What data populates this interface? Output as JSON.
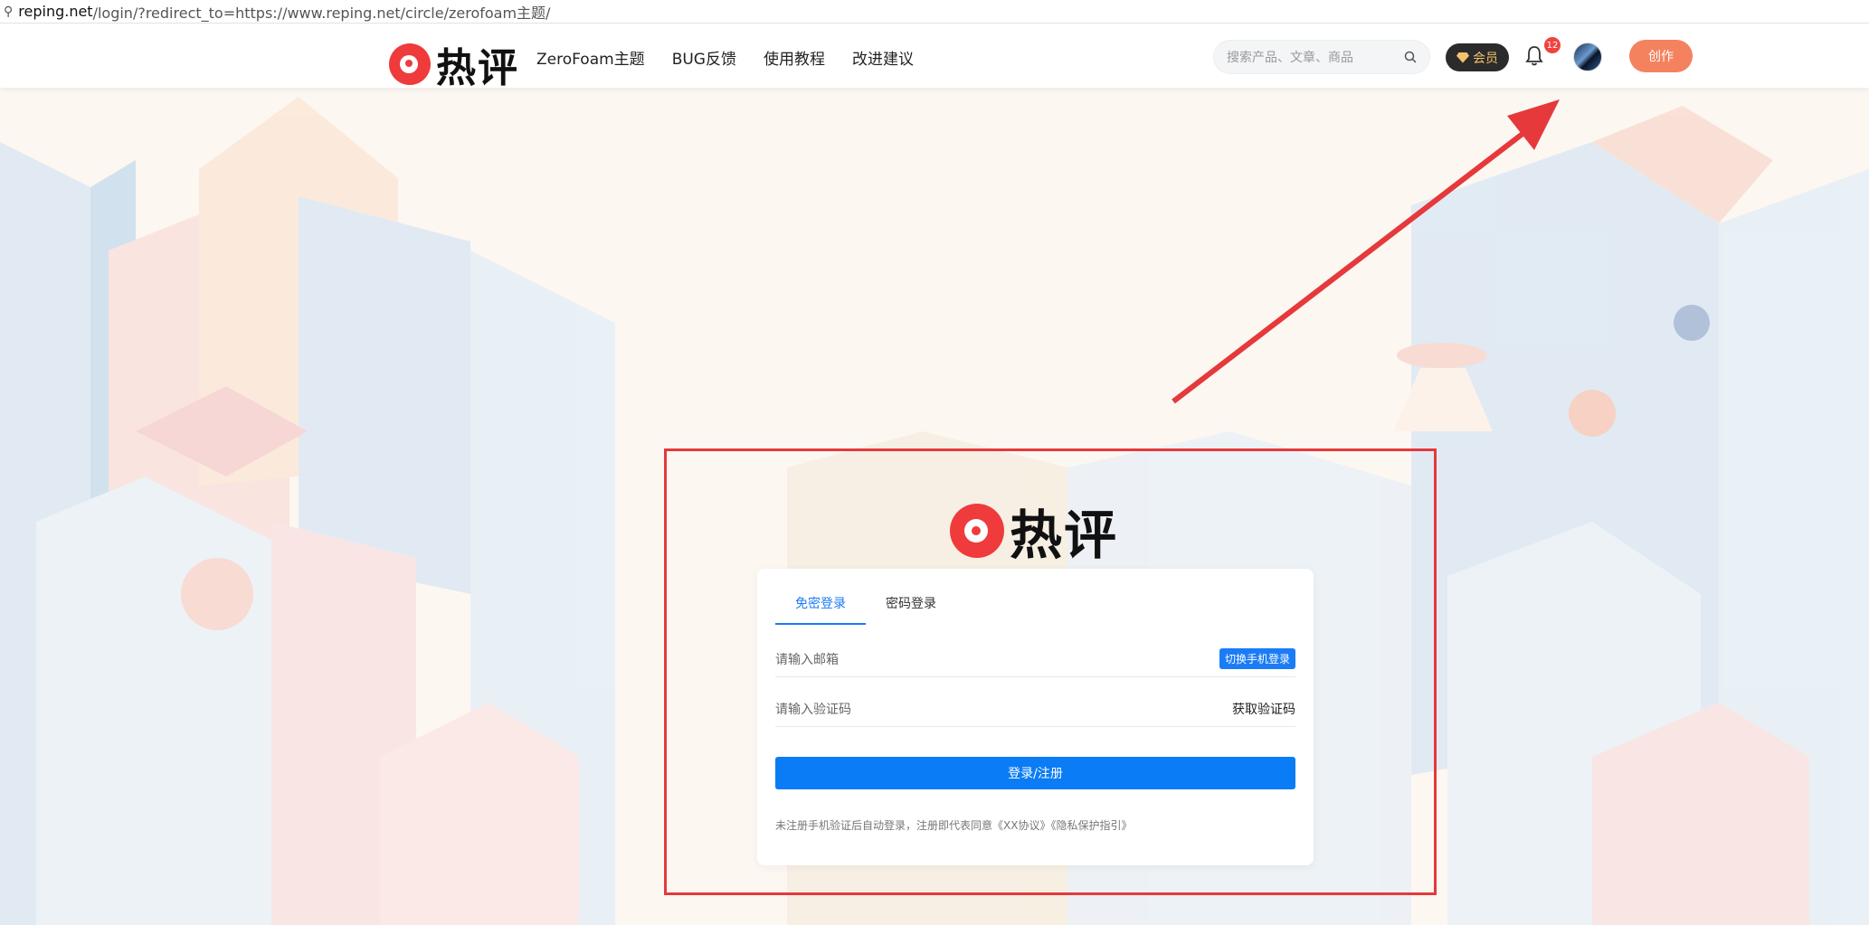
{
  "address_bar": {
    "host": "reping.net",
    "path": "/login/?redirect_to=https://www.reping.net/circle/zerofoam主题/"
  },
  "header": {
    "logo_text": "热评",
    "nav": [
      "ZeroFoam主题",
      "BUG反馈",
      "使用教程",
      "改进建议"
    ],
    "search_placeholder": "搜索产品、文章、商品",
    "vip_label": "会员",
    "notification_count": "12",
    "create_label": "创作"
  },
  "login": {
    "logo_text": "热评",
    "tabs": [
      "免密登录",
      "密码登录"
    ],
    "active_tab": 0,
    "email_placeholder": "请输入邮箱",
    "switch_phone_label": "切换手机登录",
    "code_placeholder": "请输入验证码",
    "get_code_label": "获取验证码",
    "submit_label": "登录/注册",
    "agreement": "未注册手机验证后自动登录，注册即代表同意《XX协议》《隐私保护指引》"
  },
  "colors": {
    "brand_red": "#ef3b3b",
    "primary_blue": "#0a7cf6",
    "create_orange": "#f5825f",
    "annotation_red": "#e5393b"
  }
}
